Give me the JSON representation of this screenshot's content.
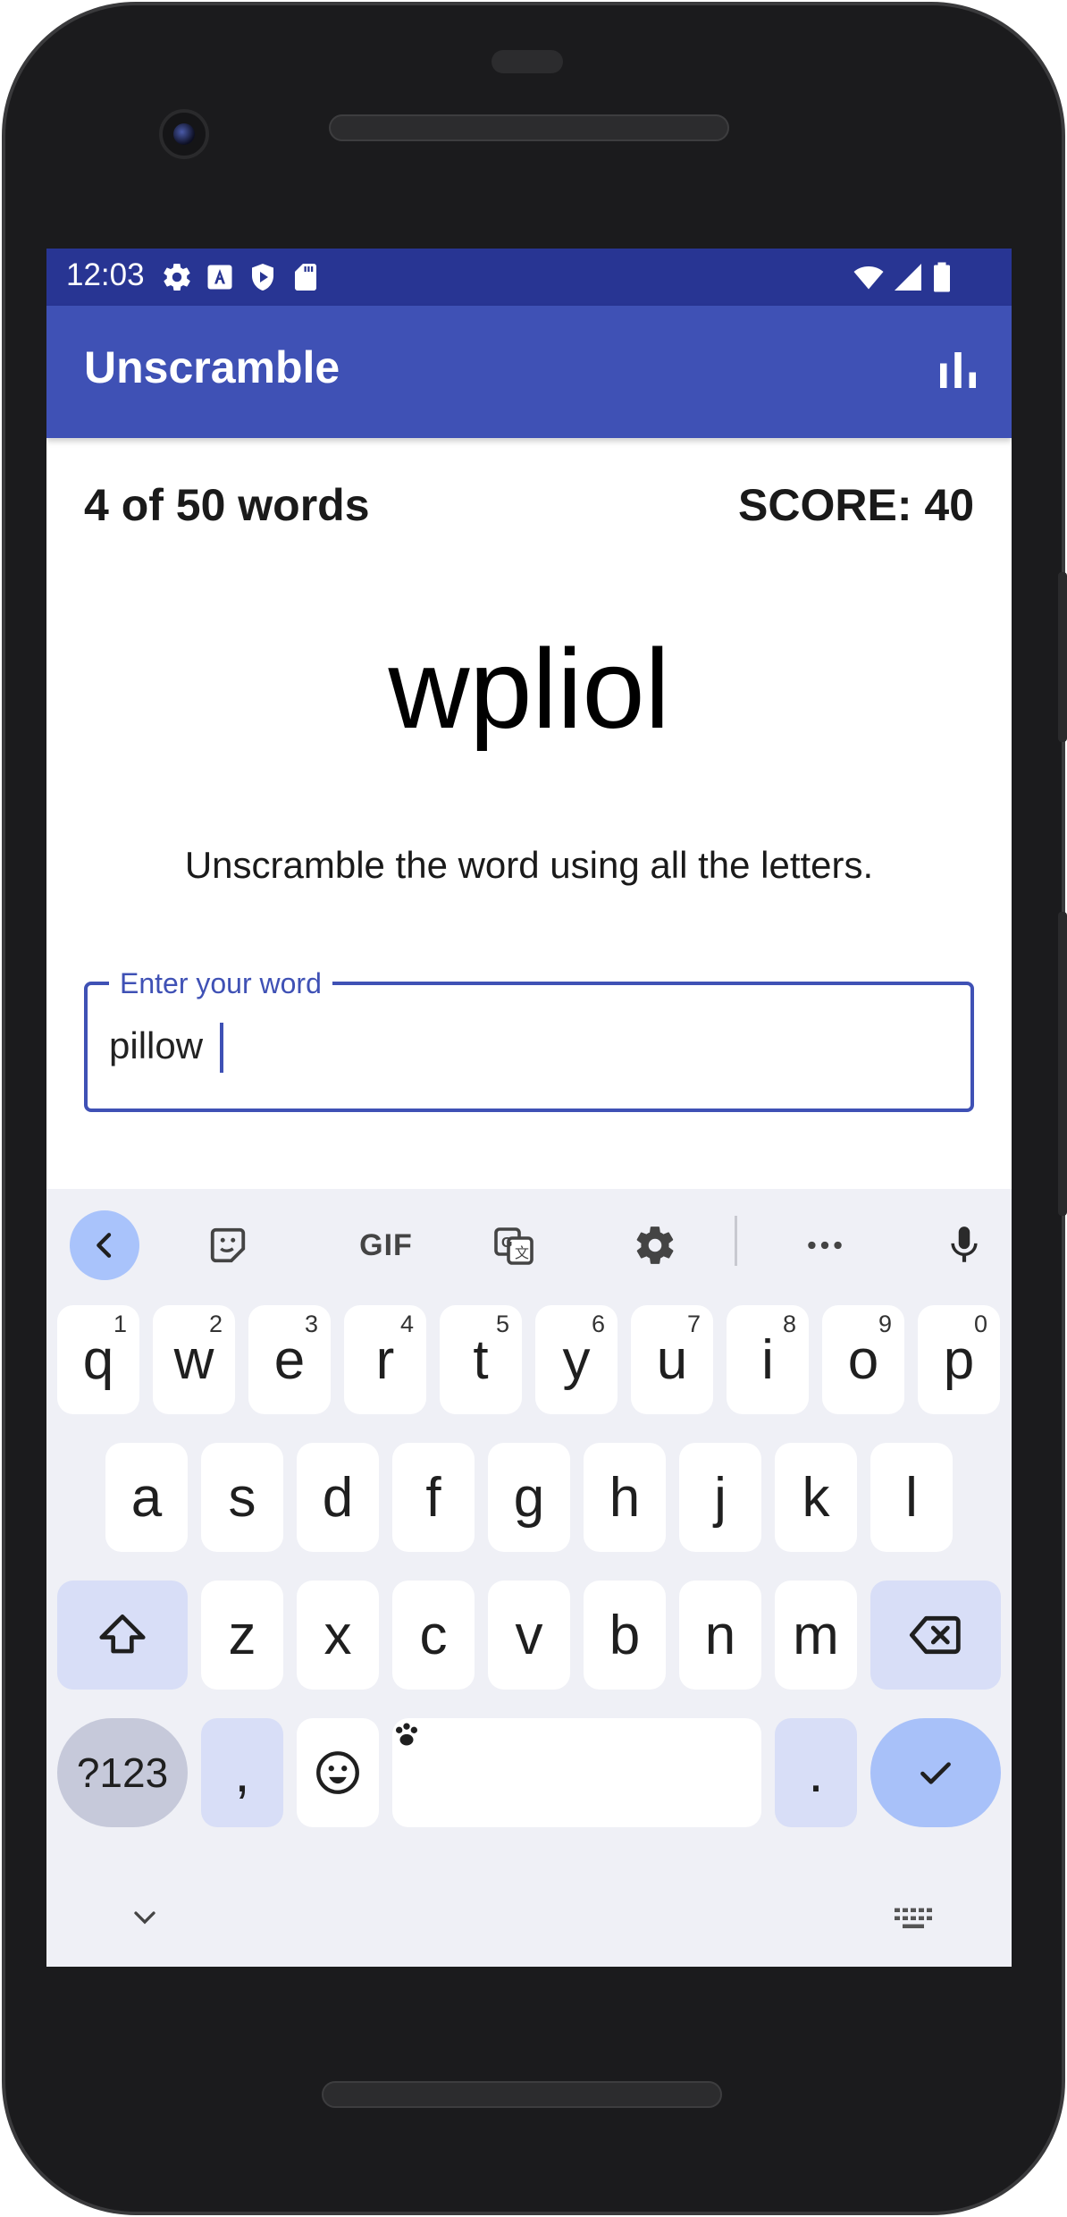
{
  "status_bar": {
    "time": "12:03",
    "icons": [
      "settings-icon",
      "text-a-icon",
      "play-shield-icon",
      "sd-card-icon",
      "wifi-icon",
      "signal-icon",
      "battery-icon"
    ]
  },
  "app_bar": {
    "title": "Unscramble",
    "action_icon": "bar-chart-icon"
  },
  "game": {
    "word_count": "4 of 50 words",
    "score": "SCORE: 40",
    "scrambled_word": "wpliol",
    "instructions": "Unscramble the word using all the letters."
  },
  "input": {
    "label": "Enter your word",
    "value": "pillow"
  },
  "keyboard": {
    "toolbar": [
      "back-chevron-icon",
      "sticker-icon",
      "gif-icon",
      "translate-icon",
      "settings-icon",
      "more-icon",
      "mic-icon"
    ],
    "gif_label": "GIF",
    "row1": [
      {
        "key": "q",
        "hint": "1"
      },
      {
        "key": "w",
        "hint": "2"
      },
      {
        "key": "e",
        "hint": "3"
      },
      {
        "key": "r",
        "hint": "4"
      },
      {
        "key": "t",
        "hint": "5"
      },
      {
        "key": "y",
        "hint": "6"
      },
      {
        "key": "u",
        "hint": "7"
      },
      {
        "key": "i",
        "hint": "8"
      },
      {
        "key": "o",
        "hint": "9"
      },
      {
        "key": "p",
        "hint": "0"
      }
    ],
    "row2": [
      "a",
      "s",
      "d",
      "f",
      "g",
      "h",
      "j",
      "k",
      "l"
    ],
    "row3": [
      "z",
      "x",
      "c",
      "v",
      "b",
      "n",
      "m"
    ],
    "symbols_label": "?123",
    "comma": ",",
    "period": ".",
    "colors": {
      "background": "#eff0f6",
      "modifier": "#d8def7",
      "accent": "#a8c1f9"
    }
  },
  "colors": {
    "app_bar": "#3f51b5",
    "status_bar": "#283593",
    "field_outline": "#3f51b5"
  }
}
